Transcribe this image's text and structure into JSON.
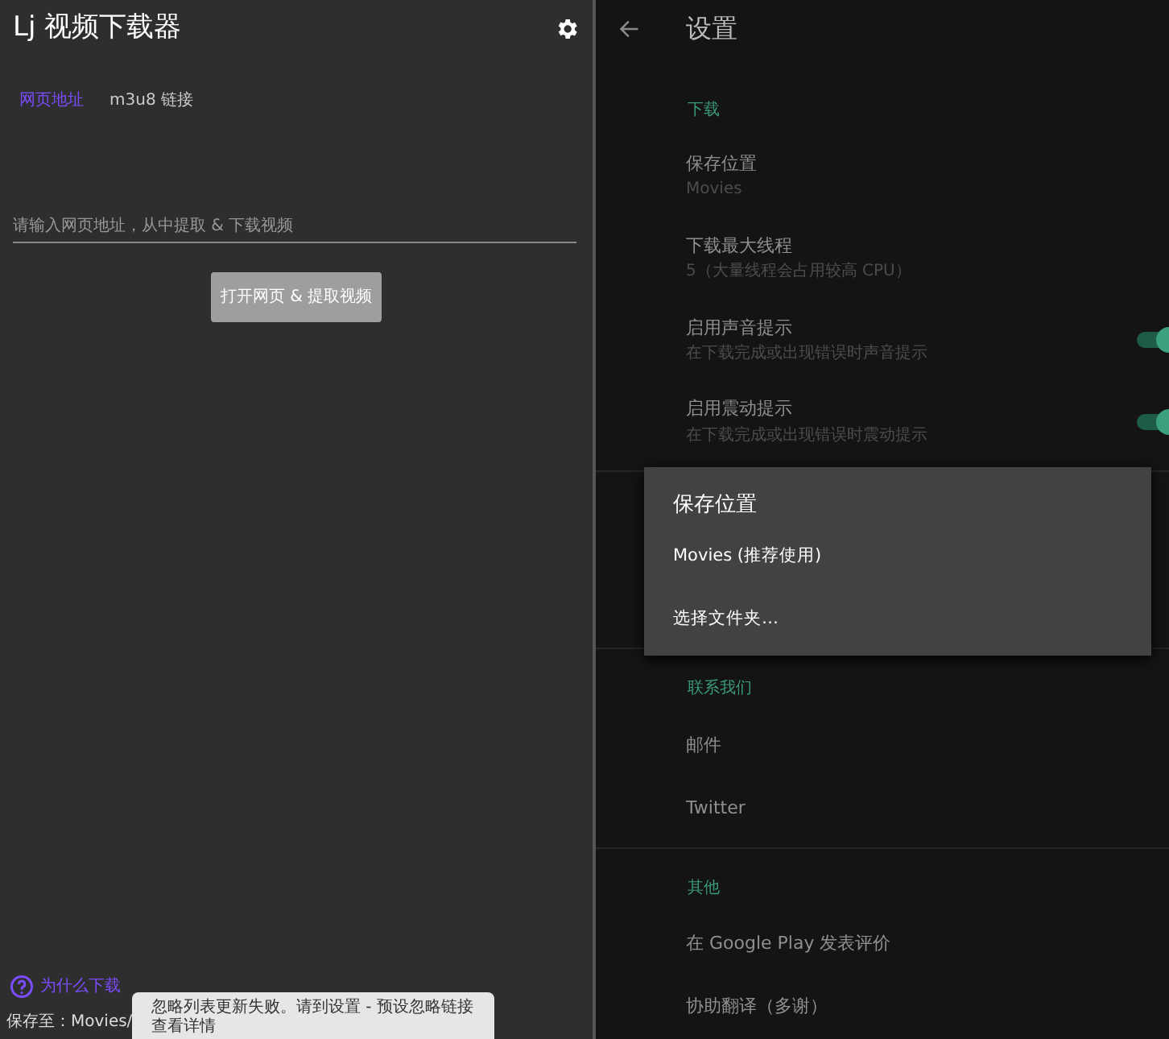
{
  "main_screen": {
    "title": "Lj 视频下载器",
    "tabs": [
      {
        "label": "网页地址",
        "selected": true
      },
      {
        "label": "m3u8 链接",
        "selected": false
      }
    ],
    "url_field": {
      "placeholder": "请输入网页地址，从中提取 & 下载视频"
    },
    "extract_button": {
      "label": "打开网页 & 提取视频"
    },
    "help_link": {
      "label": "为什么下载"
    },
    "save_path": {
      "label": "保存至：Movies/"
    },
    "toast": {
      "text": "忽略列表更新失败。请到设置 - 预设忽略链接查看详情"
    }
  },
  "settings_screen": {
    "title": "设置",
    "sections": [
      {
        "header": "下载",
        "items": [
          {
            "kind": "text",
            "title": "保存位置",
            "summary": "Movies"
          },
          {
            "kind": "text",
            "title": "下载最大线程",
            "summary": "5（大量线程会占用较高 CPU）"
          },
          {
            "kind": "switch",
            "title": "启用声音提示",
            "summary": "在下载完成或出现错误时声音提示",
            "on": true
          },
          {
            "kind": "switch",
            "title": "启用震动提示",
            "summary": "在下载完成或出现错误时震动提示",
            "on": true
          }
        ]
      },
      {
        "kind": "hidden"
      },
      {
        "header": "联系我们",
        "items": [
          {
            "kind": "text",
            "title": "邮件"
          },
          {
            "kind": "text",
            "title": "Twitter"
          }
        ]
      },
      {
        "header": "其他",
        "items": [
          {
            "kind": "text",
            "title": "在 Google Play 发表评价"
          },
          {
            "kind": "text",
            "title": "协助翻译（多谢）"
          }
        ]
      }
    ],
    "dialog": {
      "title": "保存位置",
      "options": [
        "Movies (推荐使用)",
        "选择文件夹…"
      ]
    }
  }
}
